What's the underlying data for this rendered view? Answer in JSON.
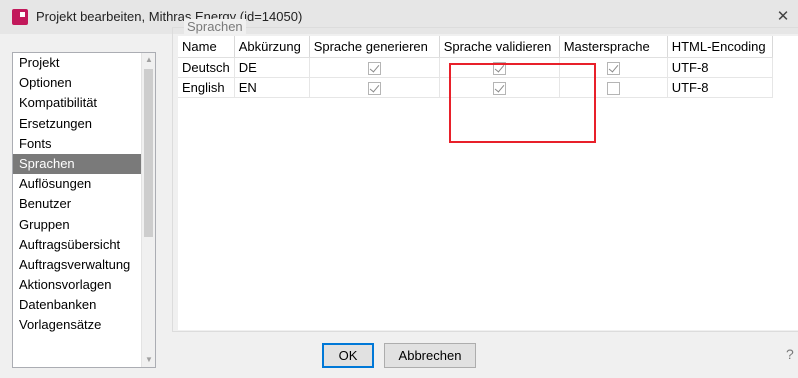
{
  "window": {
    "title": "Projekt bearbeiten, Mithras Energy (id=14050)",
    "close_symbol": "✕"
  },
  "nav": {
    "items": [
      {
        "label": "Projekt",
        "selected": false
      },
      {
        "label": "Optionen",
        "selected": false
      },
      {
        "label": "Kompatibilität",
        "selected": false
      },
      {
        "label": "Ersetzungen",
        "selected": false
      },
      {
        "label": "Fonts",
        "selected": false
      },
      {
        "label": "Sprachen",
        "selected": true
      },
      {
        "label": "Auflösungen",
        "selected": false
      },
      {
        "label": "Benutzer",
        "selected": false
      },
      {
        "label": "Gruppen",
        "selected": false
      },
      {
        "label": "Auftragsübersicht",
        "selected": false
      },
      {
        "label": "Auftragsverwaltung",
        "selected": false
      },
      {
        "label": "Aktionsvorlagen",
        "selected": false
      },
      {
        "label": "Datenbanken",
        "selected": false
      },
      {
        "label": "Vorlagensätze",
        "selected": false
      }
    ]
  },
  "section": {
    "legend": "Sprachen"
  },
  "table": {
    "columns": [
      "Name",
      "Abkürzung",
      "Sprache generieren",
      "Sprache validieren",
      "Mastersprache",
      "HTML-Encoding"
    ],
    "rows": [
      {
        "name": "Deutsch",
        "abbr": "DE",
        "generate": true,
        "validate": true,
        "master": true,
        "encoding": "UTF-8"
      },
      {
        "name": "English",
        "abbr": "EN",
        "generate": true,
        "validate": true,
        "master": false,
        "encoding": "UTF-8"
      }
    ]
  },
  "buttons": {
    "ok": "OK",
    "cancel": "Abbrechen",
    "help": "?"
  },
  "colors": {
    "highlight": "#e8202a",
    "selected_nav": "#7a7a7a",
    "app_icon": "#c2185b"
  }
}
